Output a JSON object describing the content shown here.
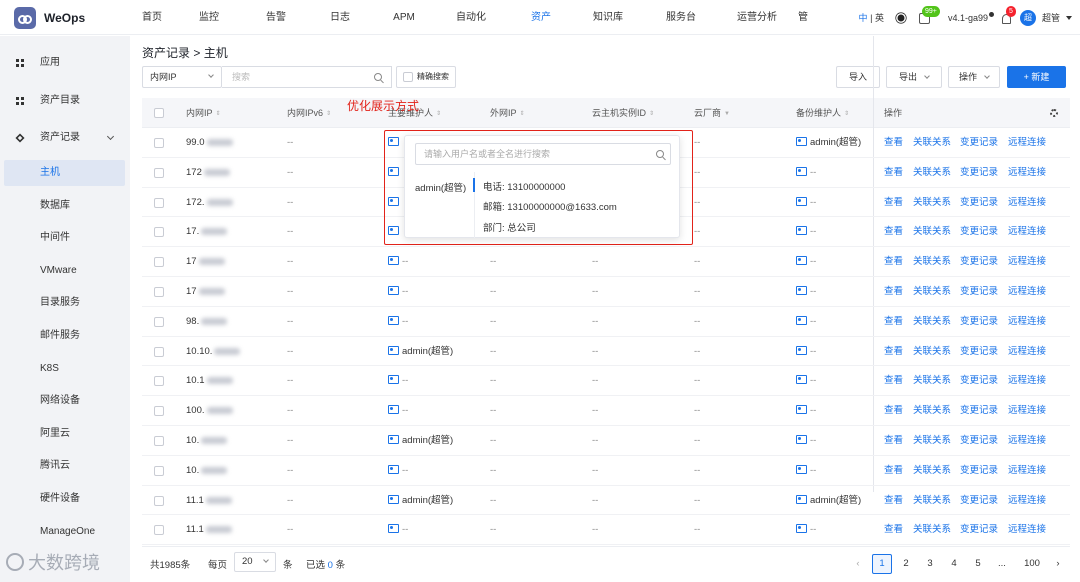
{
  "app": {
    "name": "WeOps"
  },
  "nav": {
    "items": [
      "首页",
      "监控",
      "告警",
      "日志",
      "APM",
      "自动化",
      "资产",
      "知识库",
      "服务台",
      "运营分析",
      "管"
    ],
    "active_index": 6
  },
  "top_right": {
    "lang_zh": "中",
    "lang_sep": "|",
    "lang_en": "英",
    "notice_badge": "99+",
    "version": "v4.1-ga99",
    "bell_badge": "5",
    "avatar_text": "超",
    "user_name": "超管"
  },
  "sidebar": {
    "sections": [
      {
        "label": "应用",
        "icon": "grid-icon"
      },
      {
        "label": "资产目录",
        "icon": "grid-icon"
      },
      {
        "label": "资产记录",
        "icon": "layers-icon",
        "expanded": true
      }
    ],
    "sub_items": [
      "主机",
      "数据库",
      "中间件",
      "VMware",
      "目录服务",
      "邮件服务",
      "K8S",
      "网络设备",
      "阿里云",
      "腾讯云",
      "硬件设备",
      "ManageOne"
    ],
    "active_sub": "主机"
  },
  "breadcrumb": {
    "parent": "资产记录",
    "sep": ">",
    "current": "主机"
  },
  "toolbar": {
    "field_select": "内网IP",
    "search_placeholder": "搜索",
    "exact_label": "精确搜索",
    "import_label": "导入",
    "export_label": "导出",
    "ops_label": "操作",
    "new_label": "+ 新建"
  },
  "table": {
    "columns": [
      "内网IP",
      "内网IPv6",
      "主要维护人",
      "外网IP",
      "云主机实例ID",
      "云厂商",
      "备份维护人",
      "操作"
    ],
    "rows": [
      {
        "ip": "99.0",
        "ipv6": "--",
        "owner": "",
        "ext": "",
        "cid": "",
        "vendor": "--",
        "backup": "admin(超管)"
      },
      {
        "ip": "172",
        "ipv6": "--",
        "owner": "",
        "ext": "",
        "cid": "",
        "vendor": "--",
        "backup": "--"
      },
      {
        "ip": "172.",
        "ipv6": "--",
        "owner": "",
        "ext": "",
        "cid": "",
        "vendor": "--",
        "backup": "--"
      },
      {
        "ip": "17.",
        "ipv6": "--",
        "owner": "",
        "ext": "",
        "cid": "",
        "vendor": "--",
        "backup": "--"
      },
      {
        "ip": "17",
        "ipv6": "--",
        "owner": "--",
        "ext": "--",
        "cid": "--",
        "vendor": "--",
        "backup": "--"
      },
      {
        "ip": "17",
        "ipv6": "--",
        "owner": "--",
        "ext": "--",
        "cid": "--",
        "vendor": "--",
        "backup": "--"
      },
      {
        "ip": "98.",
        "ipv6": "--",
        "owner": "--",
        "ext": "--",
        "cid": "--",
        "vendor": "--",
        "backup": "--"
      },
      {
        "ip": "10.10.",
        "ipv6": "--",
        "owner": "admin(超管)",
        "ext": "--",
        "cid": "--",
        "vendor": "--",
        "backup": "--"
      },
      {
        "ip": "10.1",
        "ipv6": "--",
        "owner": "--",
        "ext": "--",
        "cid": "--",
        "vendor": "--",
        "backup": "--"
      },
      {
        "ip": "100.",
        "ipv6": "--",
        "owner": "--",
        "ext": "--",
        "cid": "--",
        "vendor": "--",
        "backup": "--"
      },
      {
        "ip": "10.",
        "ipv6": "--",
        "owner": "admin(超管)",
        "ext": "--",
        "cid": "--",
        "vendor": "--",
        "backup": "--"
      },
      {
        "ip": "10.",
        "ipv6": "--",
        "owner": "--",
        "ext": "--",
        "cid": "--",
        "vendor": "--",
        "backup": "--"
      },
      {
        "ip": "11.1",
        "ipv6": "--",
        "owner": "admin(超管)",
        "ext": "--",
        "cid": "--",
        "vendor": "--",
        "backup": "admin(超管)"
      },
      {
        "ip": "11.1",
        "ipv6": "--",
        "owner": "--",
        "ext": "--",
        "cid": "--",
        "vendor": "--",
        "backup": "--"
      }
    ],
    "row_actions": [
      "查看",
      "关联关系",
      "变更记录",
      "远程连接"
    ]
  },
  "popover": {
    "search_placeholder": "请输入用户名或者全名进行搜索",
    "user": "admin(超管)",
    "phone": "电话: 13100000000",
    "email": "邮箱: 13100000000@1633.com",
    "dept": "部门: 总公司"
  },
  "annotation": {
    "text": "优化展示方式",
    "color": "#e2231a"
  },
  "pagination": {
    "total_text": "共1985条",
    "per_page_label": "每页",
    "per_page": "20",
    "per_page_unit": "条",
    "selected_prefix": "已选",
    "selected_count": "0",
    "selected_unit": "条",
    "pages": [
      "1",
      "2",
      "3",
      "4",
      "5",
      "...",
      "100"
    ],
    "current_page": "1"
  },
  "watermark": {
    "text": "大数跨境"
  },
  "colors": {
    "accent": "#1a73e8",
    "sidebar_bg": "#f2f3f6",
    "annotation": "#e2231a"
  }
}
